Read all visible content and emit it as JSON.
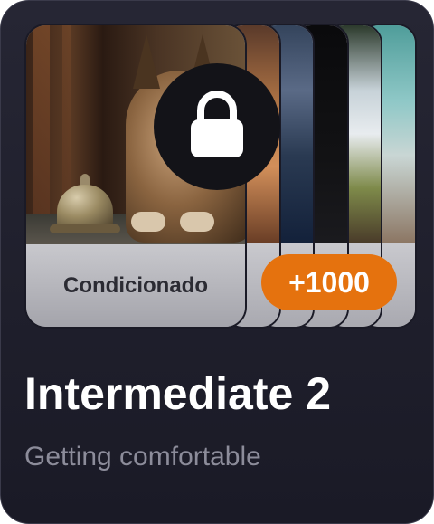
{
  "card": {
    "card_label": "Condicionado",
    "badge_count": "+1000",
    "locked": true,
    "title": "Intermediate 2",
    "subtitle": "Getting comfortable"
  },
  "colors": {
    "background": "#1e1e2a",
    "badge": "#e5720e",
    "title": "#ffffff",
    "subtitle": "#8c8c9a",
    "card_footer": "#b8b8be",
    "lock_circle": "#131318"
  },
  "icons": {
    "lock": "lock-icon"
  }
}
